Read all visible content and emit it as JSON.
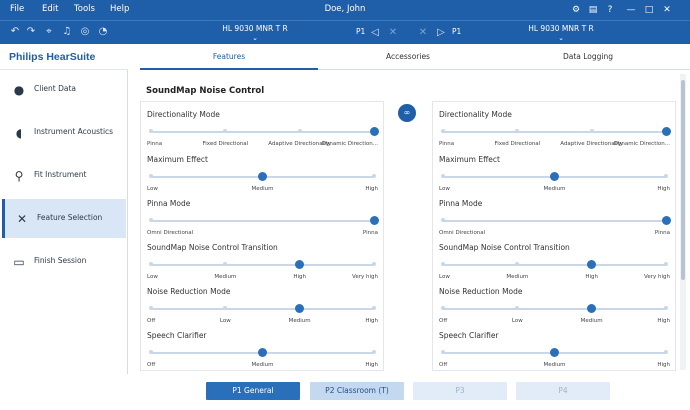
{
  "menu": {
    "file": "File",
    "edit": "Edit",
    "tools": "Tools",
    "help": "Help"
  },
  "window_title": "Doe, John",
  "window_controls": {
    "minimize": "—",
    "maximize": "□",
    "close": "✕"
  },
  "toolbar": {
    "left_device": "HL 9030 MNR T R",
    "right_device": "HL 9030 MNR T R",
    "left_program": "P1",
    "right_program": "P1",
    "chevron": "⌄"
  },
  "brand": "Philips HearSuite",
  "sidebar": {
    "items": [
      {
        "label": "Client Data",
        "icon": "person-icon"
      },
      {
        "label": "Instrument Acoustics",
        "icon": "ear-icon"
      },
      {
        "label": "Fit Instrument",
        "icon": "sliders-icon"
      },
      {
        "label": "Feature Selection",
        "icon": "tools-icon"
      },
      {
        "label": "Finish Session",
        "icon": "screen-icon"
      }
    ]
  },
  "tabs": {
    "features": "Features",
    "accessories": "Accessories",
    "data_logging": "Data Logging"
  },
  "section_title": "SoundMap Noise Control",
  "controls": {
    "directionality": {
      "title": "Directionality Mode",
      "labels": [
        "Pinna",
        "Fixed Directional",
        "Adaptive Directionality",
        "Dynamic Direction..."
      ],
      "selected": 3
    },
    "max_effect": {
      "title": "Maximum Effect",
      "labels": [
        "Low",
        "Medium",
        "High"
      ],
      "selected": 1
    },
    "pinna_mode": {
      "title": "Pinna Mode",
      "labels": [
        "Omni Directional",
        "Pinna"
      ],
      "selected": 1
    },
    "transition": {
      "title": "SoundMap Noise Control Transition",
      "labels": [
        "Low",
        "Medium",
        "High",
        "Very high"
      ],
      "selected": 2
    },
    "noise_reduction": {
      "title": "Noise Reduction Mode",
      "labels": [
        "Off",
        "Low",
        "Medium",
        "High"
      ],
      "selected": 2
    },
    "speech_clarifier": {
      "title": "Speech Clarifier",
      "labels": [
        "Off",
        "Medium",
        "High"
      ],
      "selected": 1
    }
  },
  "programs": {
    "p1": "P1 General",
    "p2": "P2 Classroom (T)",
    "p3": "P3",
    "p4": "P4"
  },
  "colors": {
    "brand": "#1f5ea8",
    "accent": "#2a6fba",
    "track": "#c8d7ea"
  }
}
